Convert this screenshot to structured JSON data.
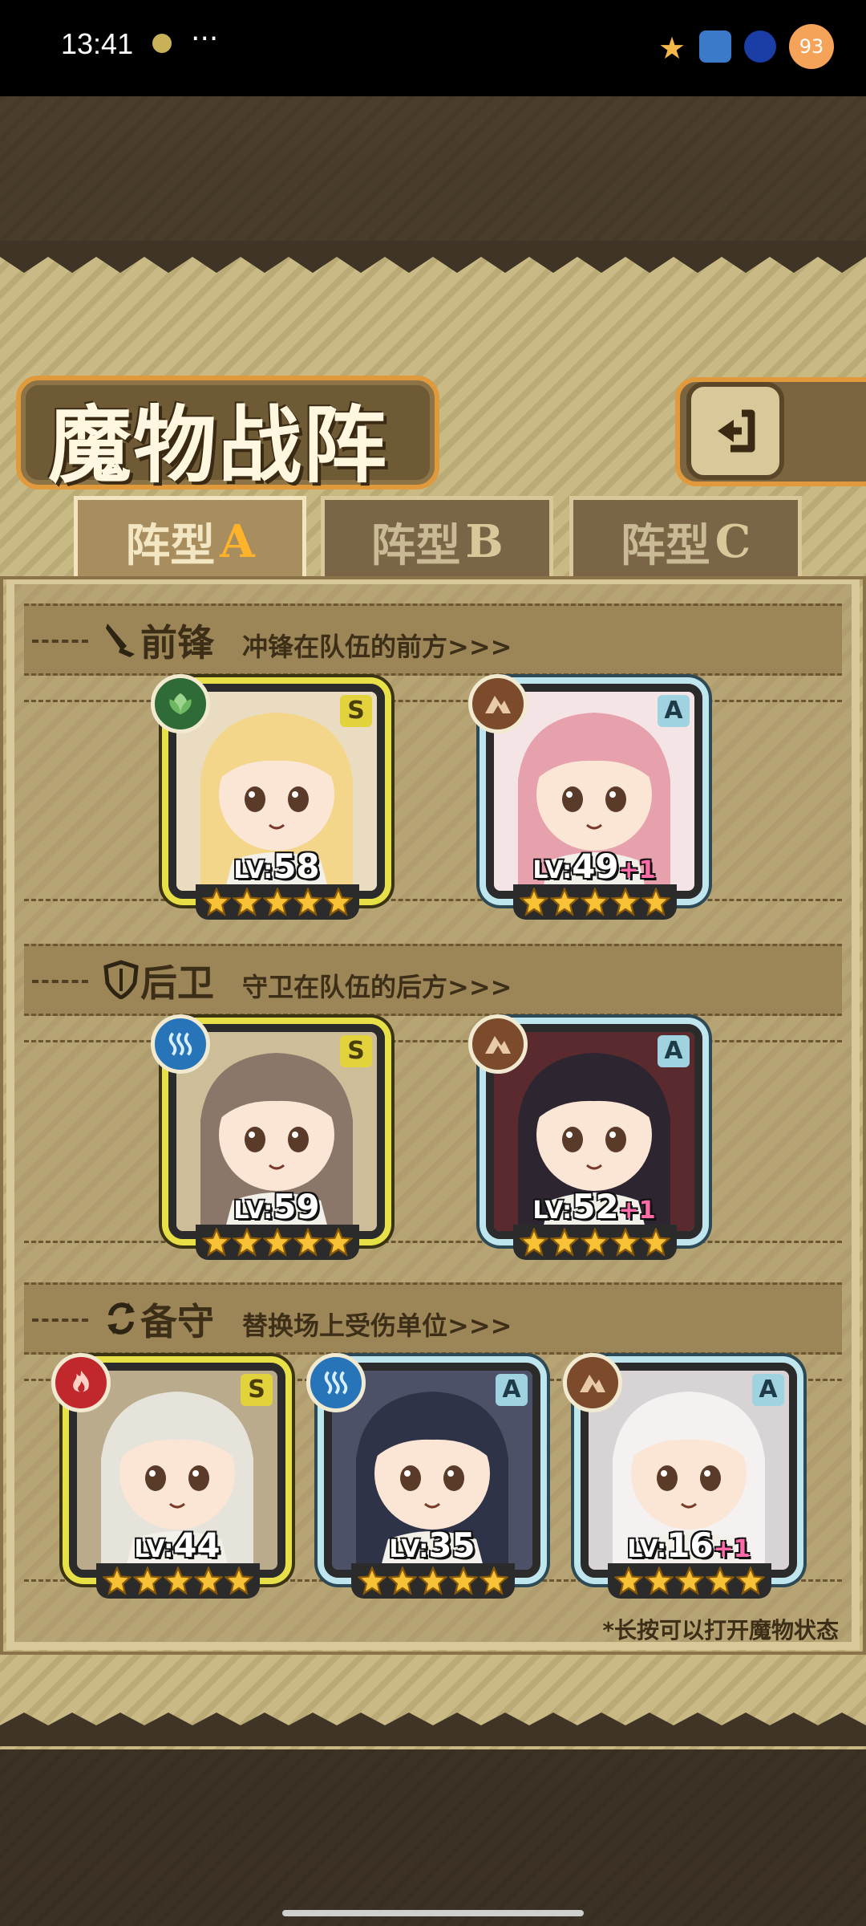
{
  "status_bar": {
    "time": "13:41",
    "more": "···",
    "battery": "93"
  },
  "header": {
    "title": "魔物战阵",
    "back_icon": "return-arrow-icon"
  },
  "tabs": [
    {
      "label": "阵型",
      "letter": "A",
      "active": true
    },
    {
      "label": "阵型",
      "letter": "B",
      "active": false
    },
    {
      "label": "阵型",
      "letter": "C",
      "active": false
    }
  ],
  "sections": {
    "front": {
      "title": "前锋",
      "subtitle": "冲锋在队伍的前方>>>",
      "icon": "sword-icon"
    },
    "back": {
      "title": "后卫",
      "subtitle": "守卫在队伍的后方>>>",
      "icon": "shield-icon"
    },
    "reserve": {
      "title": "备守",
      "subtitle": "替换场上受伤单位>>>",
      "icon": "swap-icon"
    }
  },
  "units": {
    "front": [
      {
        "rank": "S",
        "element": "grass",
        "lv_prefix": "LV:",
        "level": "58",
        "plus": "",
        "stars": 5,
        "hair": "#f3d68a",
        "bg": "#e9dcc0"
      },
      {
        "rank": "A",
        "element": "rock",
        "lv_prefix": "LV:",
        "level": "49",
        "plus": "+1",
        "stars": 5,
        "hair": "#e7a1ad",
        "bg": "#f4e4e6"
      }
    ],
    "back": [
      {
        "rank": "S",
        "element": "water",
        "lv_prefix": "LV:",
        "level": "59",
        "plus": "",
        "stars": 5,
        "hair": "#8a776a",
        "bg": "#cdbd98"
      },
      {
        "rank": "A",
        "element": "rock",
        "lv_prefix": "LV:",
        "level": "52",
        "plus": "+1",
        "stars": 5,
        "hair": "#2d2630",
        "bg": "#5a2a2e"
      }
    ],
    "reserve": [
      {
        "rank": "S",
        "element": "fire",
        "lv_prefix": "LV:",
        "level": "44",
        "plus": "",
        "stars": 5,
        "hair": "#e6e3db",
        "bg": "#b9ab8c"
      },
      {
        "rank": "A",
        "element": "water",
        "lv_prefix": "LV:",
        "level": "35",
        "plus": "",
        "stars": 5,
        "hair": "#2f3348",
        "bg": "#4d5168"
      },
      {
        "rank": "A",
        "element": "rock",
        "lv_prefix": "LV:",
        "level": "16",
        "plus": "+1",
        "stars": 5,
        "hair": "#f4f1f0",
        "bg": "#d8d4d6"
      }
    ]
  },
  "hint": "*长按可以打开魔物状态",
  "colors": {
    "accent_orange": "#e09a3c",
    "rank_s": "#e7e047",
    "rank_a": "#bfe6ef",
    "star": "#f7c235",
    "plus": "#ff6aa8"
  }
}
